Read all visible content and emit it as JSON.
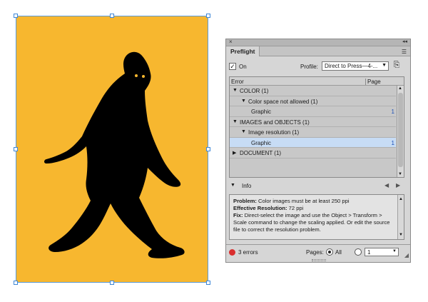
{
  "artwork": {
    "background_color": "#f7b72f",
    "silhouette_color": "#000000",
    "frame_color": "#5a9ad8",
    "icon": "bigfoot-silhouette"
  },
  "panel": {
    "close_glyph": "×",
    "collapse_glyph": "◂◂",
    "tab_label": "Preflight",
    "menu_glyph": "☰",
    "on_label": "On",
    "on_checked_glyph": "✓",
    "profile_label": "Profile:",
    "profile_value": "Direct to Press—4-...",
    "error_column": "Error",
    "page_column": "Page",
    "rows": [
      {
        "indent": 4,
        "expanded": true,
        "label": "COLOR (1)",
        "page": ""
      },
      {
        "indent": 16,
        "expanded": true,
        "label": "Color space not allowed (1)",
        "page": ""
      },
      {
        "indent": 30,
        "expanded": null,
        "label": "Graphic",
        "page": "1"
      },
      {
        "indent": 4,
        "expanded": true,
        "label": "IMAGES and OBJECTS (1)",
        "page": ""
      },
      {
        "indent": 16,
        "expanded": true,
        "label": "Image resolution (1)",
        "page": ""
      },
      {
        "indent": 30,
        "expanded": null,
        "label": "Graphic",
        "page": "1",
        "selected": true
      },
      {
        "indent": 4,
        "expanded": false,
        "label": "DOCUMENT (1)",
        "page": ""
      }
    ],
    "info_label": "Info",
    "info": {
      "problem_label": "Problem:",
      "problem_text": " Color images must be at least 250 ppi",
      "resolution_label": "Effective Resolution:",
      "resolution_text": " 72 ppi",
      "fix_label": "Fix:",
      "fix_text": " Direct-select the image and use the Object > Transform > Scale command to change the scaling applied. Or edit the source file to correct the resolution problem."
    },
    "error_count": "3 errors",
    "error_color": "#d92e2e",
    "pages_label": "Pages:",
    "all_label": "All",
    "range_value": "1"
  }
}
